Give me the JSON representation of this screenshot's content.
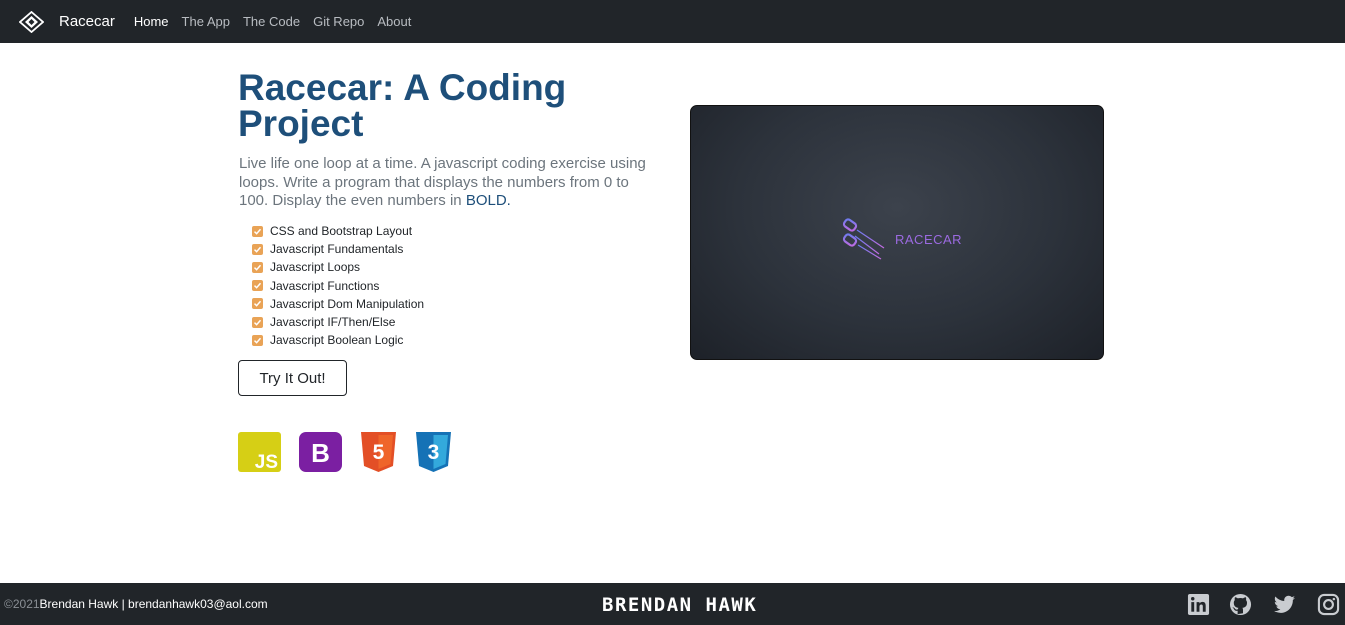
{
  "nav": {
    "brand": "Racecar",
    "links": [
      "Home",
      "The App",
      "The Code",
      "Git Repo",
      "About"
    ],
    "active_index": 0
  },
  "hero": {
    "title": "Racecar: A Coding Project",
    "lead_text": "Live life one loop at a time. A javascript coding exercise using loops. Write a program that displays the numbers from 0 to 100. Display the even numbers in",
    "lead_bold": "BOLD.",
    "checklist": [
      "CSS and Bootstrap Layout",
      "Javascript Fundamentals",
      "Javascript Loops",
      "Javascript Functions",
      "Javascript Dom Manipulation",
      "Javascript IF/Then/Else",
      "Javascript Boolean Logic"
    ],
    "button_label": "Try It Out!",
    "tech_icons": [
      "javascript-icon",
      "bootstrap-icon",
      "html5-icon",
      "css3-icon"
    ],
    "tech_labels": {
      "js": "JS",
      "bootstrap": "B",
      "html": "5",
      "css": "3"
    }
  },
  "preview": {
    "logo_text": "RACECAR"
  },
  "footer": {
    "copyright": "©2021",
    "author_contact": "Brendan Hawk | brendanhawk03@aol.com",
    "signature": "BRENDAN HAWK",
    "social_icons": [
      "linkedin-icon",
      "github-icon",
      "twitter-icon",
      "instagram-icon"
    ]
  },
  "colors": {
    "navbar": "#212529",
    "title": "#1e4f7a",
    "checkbox": "#e9a356",
    "js": "#d6cf15",
    "bootstrap": "#7b1fa2",
    "html5": "#e34f26",
    "css3": "#1572b6",
    "preview_logo": "#9b6ae0"
  }
}
